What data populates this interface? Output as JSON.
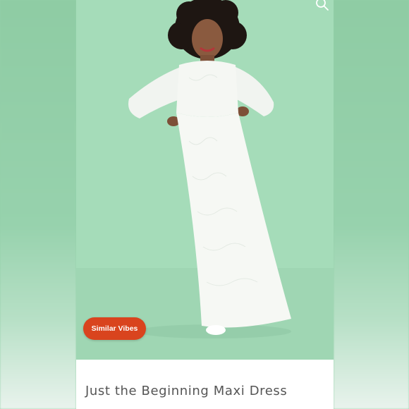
{
  "product": {
    "title": "Just the Beginning Maxi Dress",
    "similar_button_label": "Similar Vibes"
  },
  "colors": {
    "background": "#a4dcb8",
    "accent_button": "#d9441e",
    "title_text": "#555555",
    "card": "#ffffff"
  },
  "icons": {
    "search": "search-icon"
  },
  "image": {
    "subject": "model wearing white lace long-sleeve maxi dress"
  }
}
